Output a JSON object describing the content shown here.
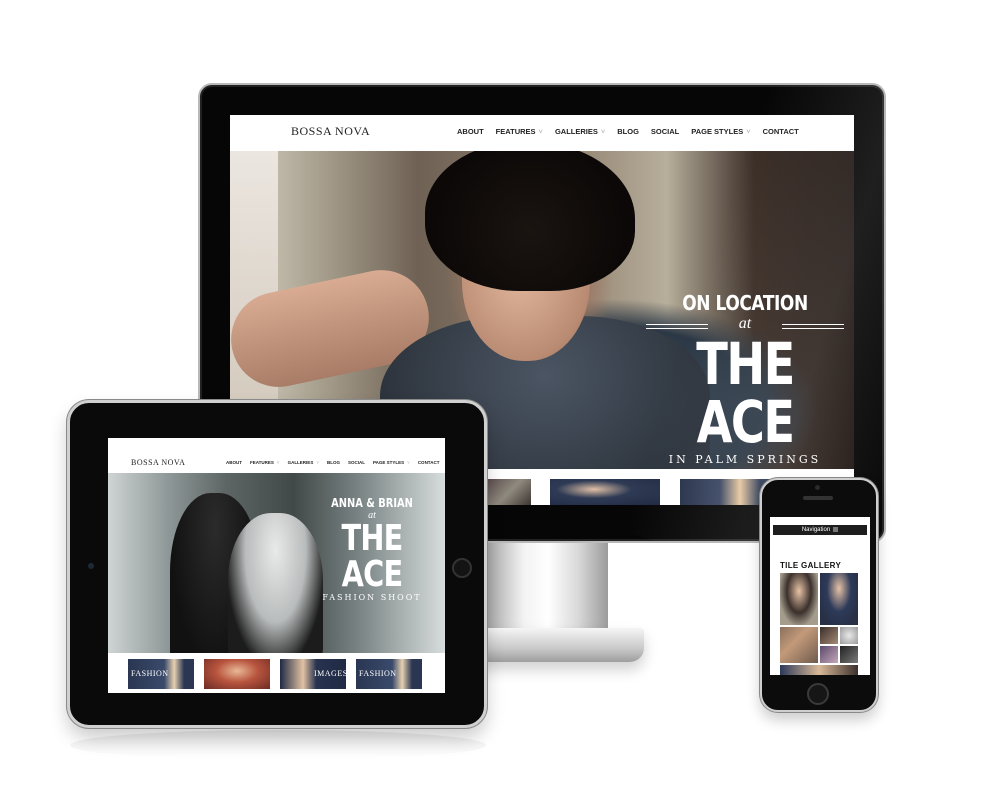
{
  "desktop": {
    "logo": "BOSSA NOVA",
    "nav": [
      {
        "label": "ABOUT",
        "has_dropdown": false
      },
      {
        "label": "FEATURES",
        "has_dropdown": true
      },
      {
        "label": "GALLERIES",
        "has_dropdown": true
      },
      {
        "label": "BLOG",
        "has_dropdown": false
      },
      {
        "label": "SOCIAL",
        "has_dropdown": false
      },
      {
        "label": "PAGE STYLES",
        "has_dropdown": true
      },
      {
        "label": "CONTACT",
        "has_dropdown": false
      }
    ],
    "hero": {
      "line1": "ON LOCATION",
      "at": "at",
      "main": "THE ACE",
      "sub": "IN PALM SPRINGS"
    }
  },
  "tablet": {
    "logo": "BOSSA NOVA",
    "nav": [
      {
        "label": "ABOUT",
        "has_dropdown": false
      },
      {
        "label": "FEATURES",
        "has_dropdown": true
      },
      {
        "label": "GALLERIES",
        "has_dropdown": true
      },
      {
        "label": "BLOG",
        "has_dropdown": false
      },
      {
        "label": "SOCIAL",
        "has_dropdown": false
      },
      {
        "label": "PAGE STYLES",
        "has_dropdown": true
      },
      {
        "label": "CONTACT",
        "has_dropdown": false
      }
    ],
    "hero": {
      "line1": "ANNA & BRIAN",
      "at": "at",
      "main": "THE ACE",
      "sub": "FASHION SHOOT"
    },
    "thumbs": [
      {
        "label": "FASHION"
      },
      {
        "label": ""
      },
      {
        "label": "IMAGES"
      },
      {
        "label": "FASHION"
      }
    ]
  },
  "phone": {
    "nav_label": "Navigation",
    "section_title": "TILE GALLERY"
  },
  "colors": {
    "nav_text": "#222222",
    "bezel": "#0a0a0a",
    "hero_text": "#ffffff"
  }
}
